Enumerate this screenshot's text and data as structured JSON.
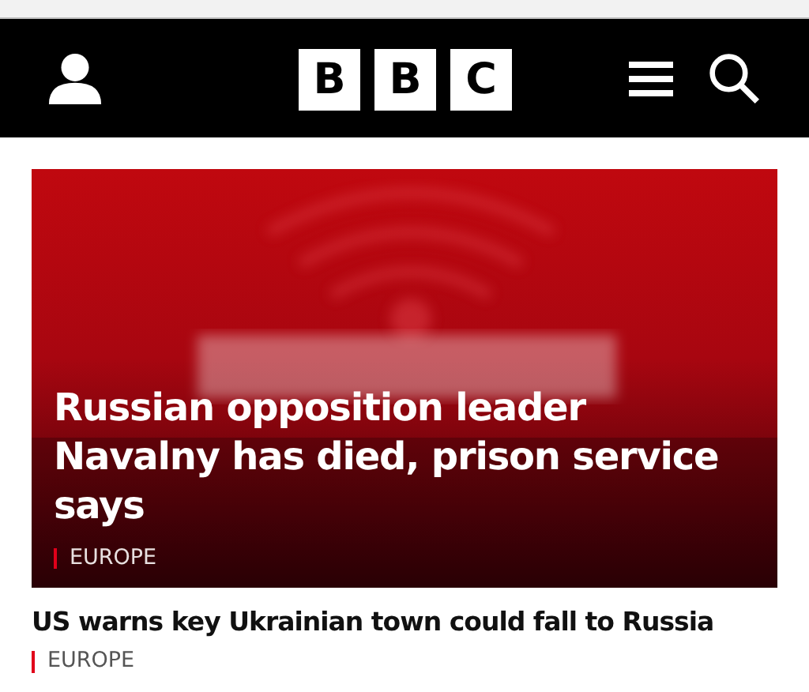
{
  "header": {
    "logo": [
      "B",
      "B",
      "C"
    ]
  },
  "stories": [
    {
      "kind": "lead",
      "headline": "Russian opposition leader Navalny has died, prison service says",
      "category": "EUROPE"
    },
    {
      "kind": "plain",
      "headline": "US warns key Ukrainian town could fall to Russia",
      "category": "EUROPE"
    }
  ]
}
